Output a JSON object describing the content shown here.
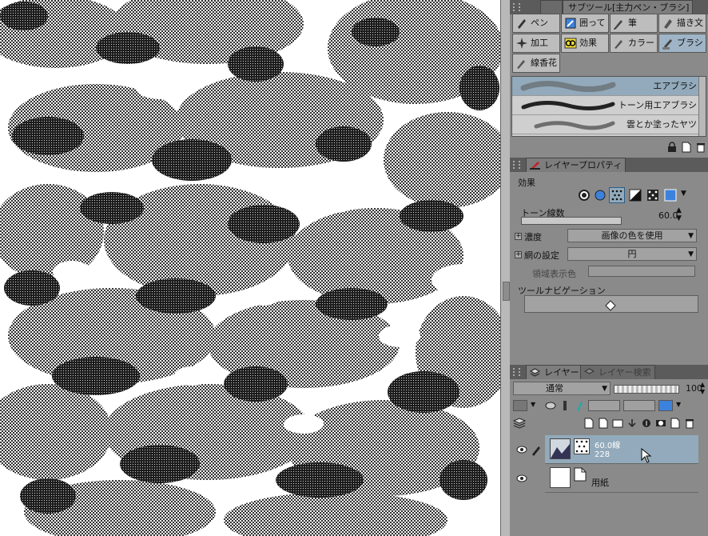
{
  "subtool": {
    "tab_label": "サブツール[主力ペン・ブラシ]",
    "groups": [
      {
        "label": "ペン",
        "icon": "pen-icon",
        "active": false
      },
      {
        "label": "囲って",
        "icon": "enclose-icon",
        "active": false
      },
      {
        "label": "筆",
        "icon": "brush-icon",
        "active": false
      },
      {
        "label": "描き文",
        "icon": "write-icon",
        "active": false
      },
      {
        "label": "加工",
        "icon": "sparkle-icon",
        "active": false
      },
      {
        "label": "効果",
        "icon": "effect-icon",
        "active": false
      },
      {
        "label": "カラー",
        "icon": "color-brush-icon",
        "active": false
      },
      {
        "label": "ブラシ",
        "icon": "airbrush-icon",
        "active": true
      },
      {
        "label": "線香花",
        "icon": "sparkler-icon",
        "active": false
      }
    ],
    "brushes": [
      {
        "label": "エアブラシ",
        "selected": true
      },
      {
        "label": "トーン用エアブラシ",
        "selected": false
      },
      {
        "label": "雲とか塗ったヤツ",
        "selected": false
      }
    ]
  },
  "layer_property": {
    "tab_label": "レイヤープロパティ",
    "effect_label": "効果",
    "tone_lines_label": "トーン線数",
    "tone_lines_value": "60.0",
    "density_label": "濃度",
    "density_value": "画像の色を使用",
    "screen_label": "網の設定",
    "screen_value": "円",
    "area_color_label": "領域表示色",
    "tool_nav_label": "ツールナビゲーション"
  },
  "layers": {
    "tab_label": "レイヤー",
    "tab2_label": "レイヤー検索",
    "blend_mode": "通常",
    "opacity": "100",
    "items": [
      {
        "name": "60.0線",
        "sub": "228",
        "selected": true
      },
      {
        "name": "用紙",
        "sub": "",
        "selected": false
      }
    ]
  },
  "colors": {
    "panel_bg": "#8a8a8a",
    "header_bg": "#5b5b5b",
    "selected_blue": "#92aabb",
    "accent_blue": "#3c82dc"
  }
}
